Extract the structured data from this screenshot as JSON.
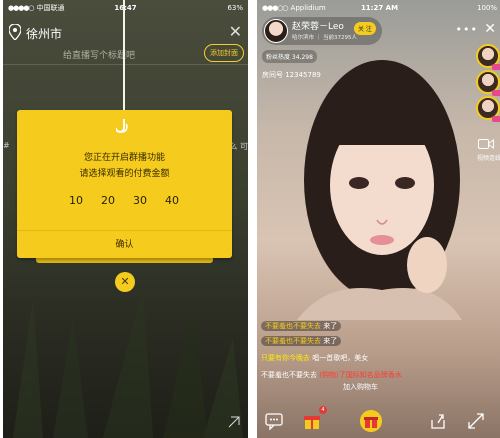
{
  "left": {
    "status": {
      "carrier": "中国联通",
      "time": "16:47",
      "battery": "63%"
    },
    "city": "徐州市",
    "title_placeholder": "给直播写个标题吧",
    "cover_button": "添加封面",
    "side_left": "#",
    "side_right": "么 可",
    "modal": {
      "line1": "您正在开启群播功能",
      "line2": "请选择观看的付费金额",
      "prices": [
        "10",
        "20",
        "30",
        "40"
      ],
      "confirm": "确认"
    },
    "icons": [
      "location-pin-icon",
      "close-icon",
      "hook-icon",
      "close-circle-icon",
      "shrink-icon"
    ]
  },
  "right": {
    "status": {
      "carrier": "Applidium",
      "time": "11:27 AM",
      "battery": "100%"
    },
    "host": {
      "name": "赵荣蓉－Leo",
      "meta": "哈尔滨市 ｜ 当前37295人",
      "follow": "关 注"
    },
    "heat": "粉丝热度 34,298",
    "room": "房间号 12345789",
    "video_link": "视频连线",
    "chat": [
      {
        "name": "不要羞也不要失去",
        "text": "来了",
        "style": "pill"
      },
      {
        "name": "不要羞也不要失去",
        "text": "来了",
        "style": "pill"
      },
      {
        "name": "只要有你今晚去",
        "text": "唱一首歌吧，美女",
        "style": "yellow"
      },
      {
        "name": "不要羞也不要失去",
        "text": "(购物)了国际知名品牌香水",
        "extra": "加入购物车",
        "style": "red"
      }
    ],
    "gift_count": "4",
    "icons": [
      "chat-icon",
      "gift-icon",
      "gift-center-icon",
      "share-icon",
      "fullscreen-icon"
    ]
  }
}
